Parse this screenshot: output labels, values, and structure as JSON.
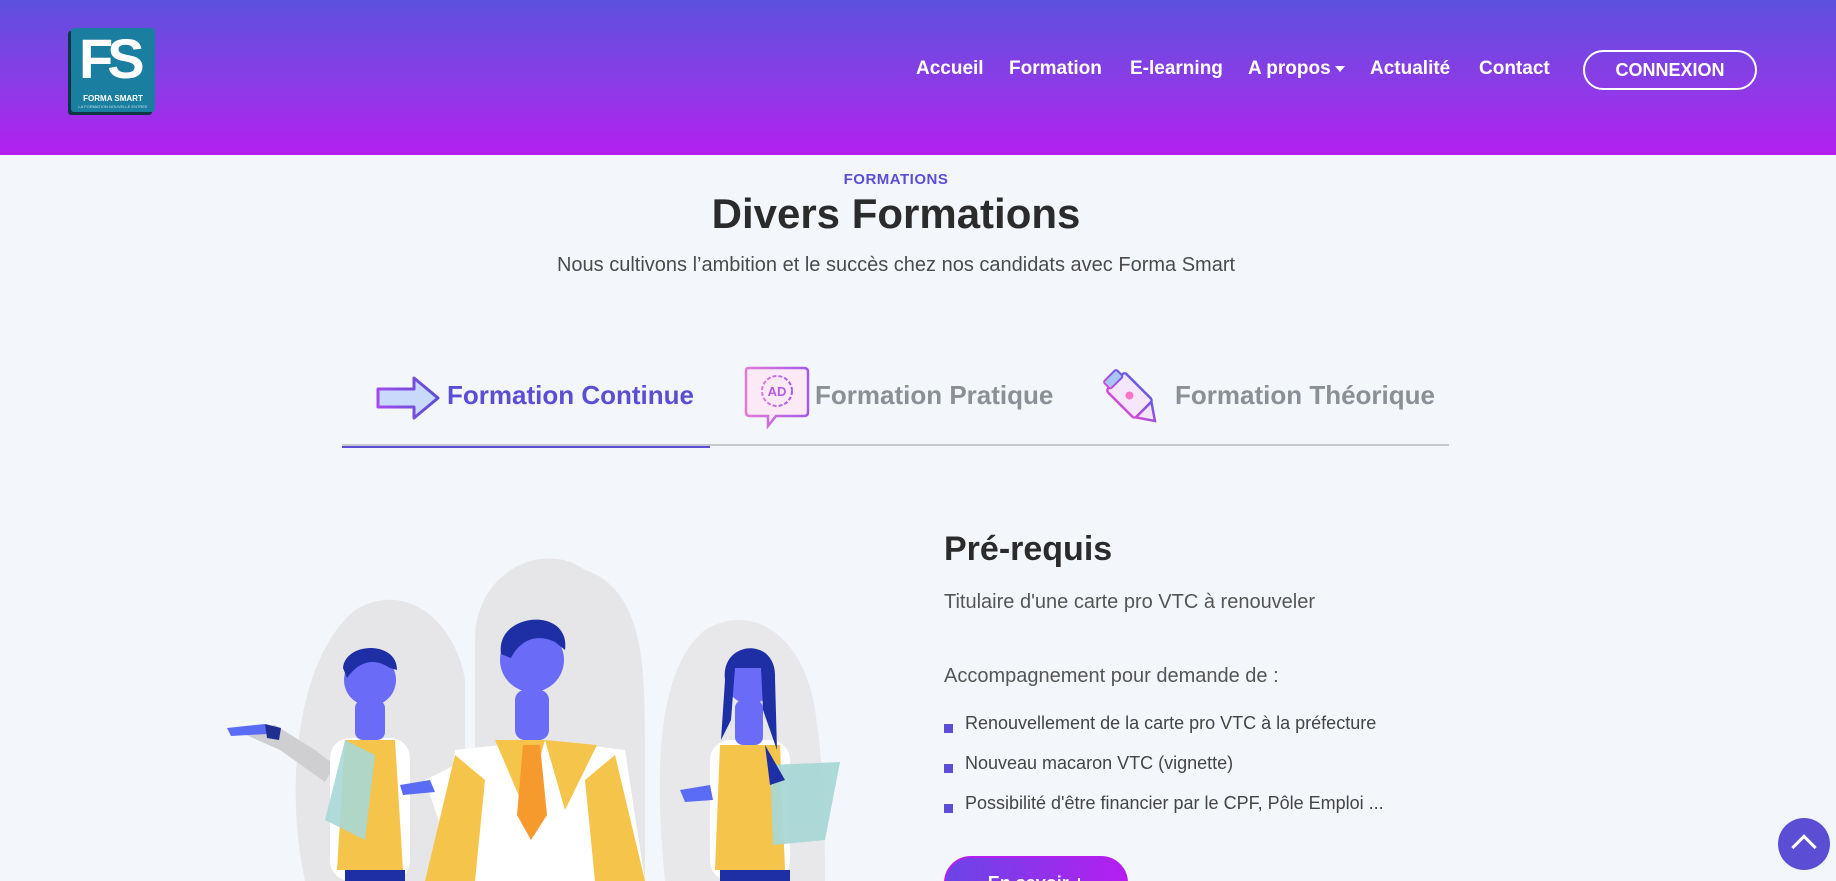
{
  "header": {
    "logo": {
      "mark": "FS",
      "brand": "FORMA SMART",
      "tagline": "LA FORMATION NOUVELLE ENTREE"
    },
    "nav": [
      {
        "label": "Accueil"
      },
      {
        "label": "Formation"
      },
      {
        "label": "E-learning"
      },
      {
        "label": "A propos",
        "dropdown": true
      },
      {
        "label": "Actualité"
      },
      {
        "label": "Contact"
      }
    ],
    "login_label": "CONNEXION"
  },
  "section": {
    "eyebrow": "FORMATIONS",
    "title": "Divers Formations",
    "subtitle": "Nous cultivons l’ambition et le succès chez nos candidats avec Forma Smart"
  },
  "tabs": [
    {
      "label": "Formation Continue",
      "icon": "arrow-right-icon",
      "active": true
    },
    {
      "label": "Formation Pratique",
      "icon": "ad-badge-icon",
      "active": false
    },
    {
      "label": "Formation Théorique",
      "icon": "pen-icon",
      "active": false
    }
  ],
  "content": {
    "title": "Pré-requis",
    "text": "Titulaire d'une carte pro VTC à renouveler",
    "text2": "Accompagnement pour demande de :",
    "bullets": [
      "Renouvellement de la carte pro VTC à la préfecture",
      "Nouveau macaron VTC (vignette)",
      "Possibilité d'être financier par le CPF, Pôle Emploi ..."
    ],
    "cta_label": "En savoir +"
  },
  "colors": {
    "accent": "#5a4fd4",
    "header_top": "#5d50de",
    "header_bottom": "#b41ff0",
    "inactive_tab": "#8a8f98",
    "background": "#f3f6fb"
  }
}
